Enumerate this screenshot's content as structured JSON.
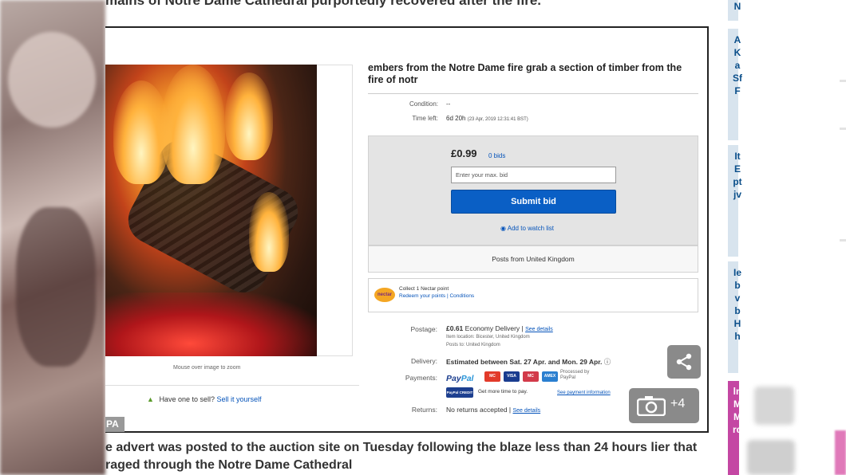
{
  "article": {
    "caption_top": "mains of Notre Dame Cathedral purportedly recovered after the fire.",
    "caption_bottom": "e advert was posted to the auction site on Tuesday following the blaze less than 24 hours lier that raged through the Notre Dame Cathedral",
    "photo_credit": "PA"
  },
  "listing": {
    "title": "embers from  the  Notre Dame fire grab a section of timber from the fire of notr",
    "zoom_hint": "Mouse over image to zoom",
    "sell_prompt": "Have one to sell?",
    "sell_link": "Sell it yourself",
    "condition_label": "Condition:",
    "condition_value": "--",
    "time_left_label": "Time left:",
    "time_left_value": "6d 20h",
    "time_left_detail": "(23 Apr, 2019  12:31:41 BST)",
    "price": "£0.99",
    "bids": "0 bids",
    "bid_placeholder": "Enter your max. bid",
    "submit_bid": "Submit bid",
    "watch_list": "Add to watch list",
    "posts_from": "Posts from United Kingdom",
    "nectar_logo": "nectar",
    "nectar_line1": "Collect 1 Nectar point",
    "nectar_line2": "Redeem your points | Conditions",
    "postage_label": "Postage:",
    "postage_value": "£0.61",
    "postage_service": "Economy Delivery |",
    "postage_link": "See details",
    "item_location": "Item location:  Bicester, United Kingdom",
    "posts_to": "Posts to:  United Kingdom",
    "delivery_label": "Delivery:",
    "delivery_value": "Estimated between Sat. 27 Apr. and Mon. 29 Apr.",
    "payments_label": "Payments:",
    "paypal_a": "Pay",
    "paypal_b": "Pal",
    "processed_by": "Processed by PayPal",
    "paypal_credit": "PayPal CREDIT",
    "more_time": "Get more time to pay.",
    "payment_info_link": "See payment information",
    "returns_label": "Returns:",
    "returns_value": "No returns accepted |",
    "returns_link": "See details",
    "cards": [
      "MC",
      "VISA",
      "MC",
      "AMEX"
    ]
  },
  "overlay": {
    "photo_count": "+4"
  },
  "sidebar": {
    "letters_1": "N",
    "letters_2": "AKaSfF",
    "letters_3": "ItEptjv",
    "letters_4": "IebvbHh",
    "letters_pink": "lnMMrd"
  },
  "colors": {
    "accent": "#0a5fc5",
    "link": "#0654ba",
    "sidebar_pink": "#c447a3"
  }
}
